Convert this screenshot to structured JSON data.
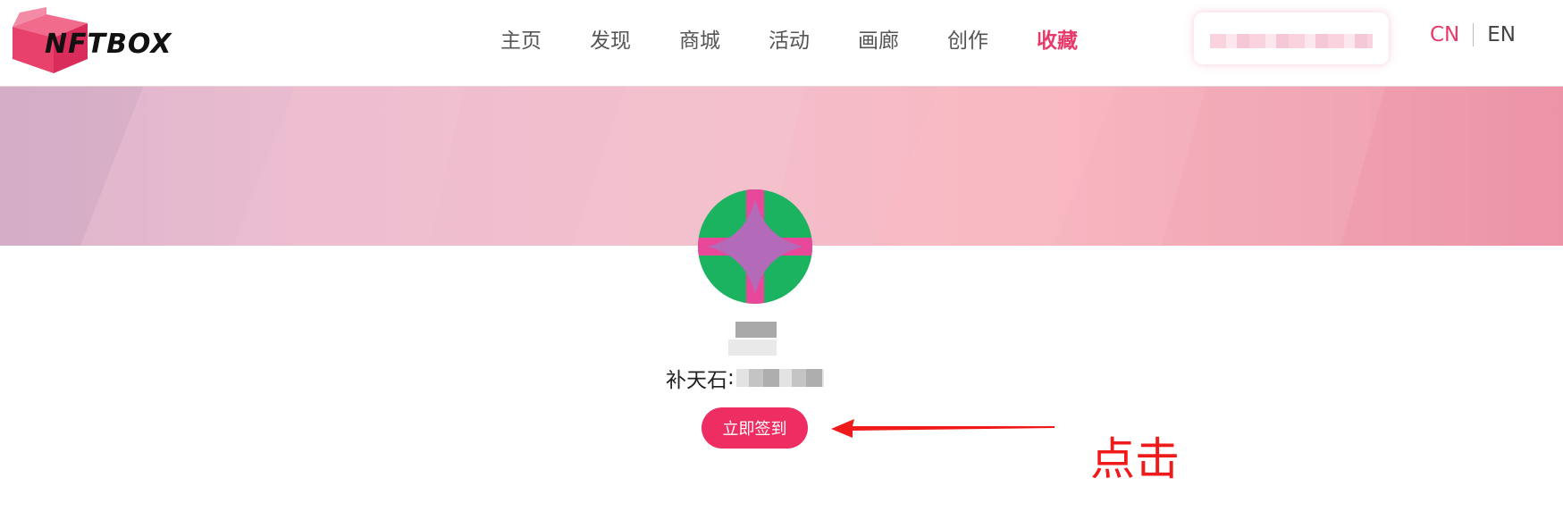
{
  "brand": {
    "logo_text": "NFTBOX",
    "accent": "#e83a6a"
  },
  "nav": {
    "items": [
      {
        "label": "主页",
        "active": false
      },
      {
        "label": "发现",
        "active": false
      },
      {
        "label": "商城",
        "active": false
      },
      {
        "label": "活动",
        "active": false
      },
      {
        "label": "画廊",
        "active": false
      },
      {
        "label": "创作",
        "active": false
      },
      {
        "label": "收藏",
        "active": true
      }
    ]
  },
  "language": {
    "cn": "CN",
    "en": "EN"
  },
  "profile": {
    "stone_label": "补天石",
    "stone_separator": ":"
  },
  "actions": {
    "signin_label": "立即签到",
    "button_color": "#ee2d62"
  },
  "annotation": {
    "text": "点击",
    "color": "#f01a1a"
  },
  "icons": {
    "logo": "box-icon",
    "avatar": "abstract-avatar-icon",
    "arrow": "arrow-left-icon"
  }
}
